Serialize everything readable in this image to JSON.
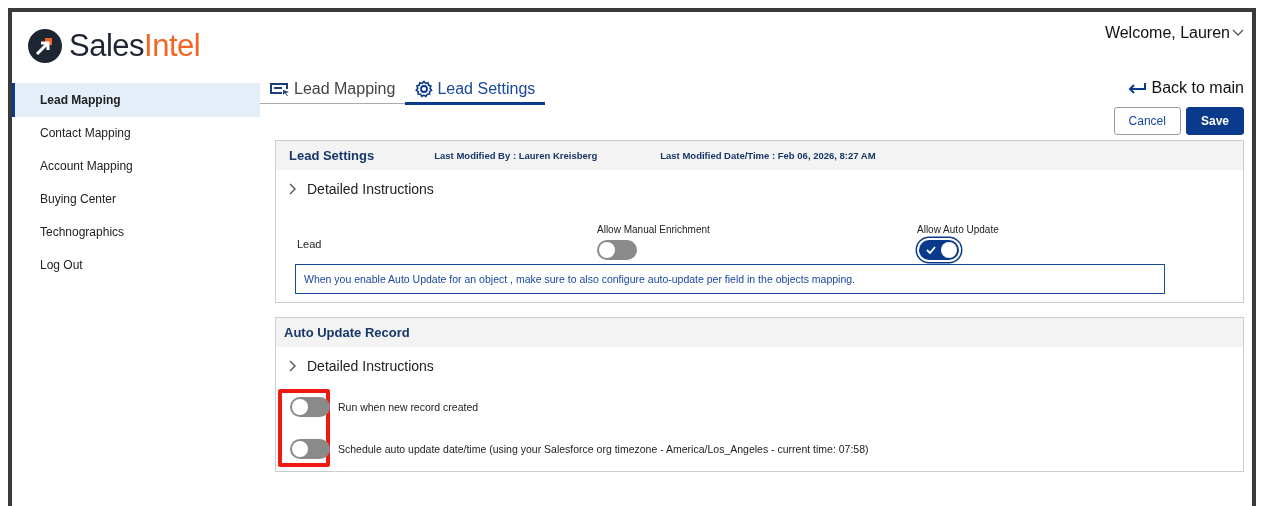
{
  "logo": {
    "dark": "Sales",
    "accent": "Intel"
  },
  "user_menu": {
    "label": "Welcome, Lauren"
  },
  "sidebar": {
    "items": [
      {
        "label": "Lead Mapping",
        "selected": true
      },
      {
        "label": "Contact Mapping",
        "selected": false
      },
      {
        "label": "Account Mapping",
        "selected": false
      },
      {
        "label": "Buying Center",
        "selected": false
      },
      {
        "label": "Technographics",
        "selected": false
      },
      {
        "label": "Log Out",
        "selected": false
      }
    ]
  },
  "tabs": [
    {
      "label": "Lead Mapping",
      "selected": false
    },
    {
      "label": "Lead Settings",
      "selected": true
    }
  ],
  "back_link": "Back to main",
  "buttons": [
    {
      "label": "Cancel",
      "kind": "secondary"
    },
    {
      "label": "Save",
      "kind": "primary"
    }
  ],
  "lead_settings": {
    "title": "Lead Settings",
    "modified_by": "Last Modified By : Lauren Kreisberg",
    "modified_at": "Last Modified Date/Time : Feb 06, 2026, 8:27 AM",
    "instructions": {
      "label": "Detailed Instructions",
      "expanded": false
    },
    "row_label": "Lead",
    "toggles": [
      {
        "label": "Allow Manual Enrichment",
        "on": false
      },
      {
        "label": "Allow Auto Update",
        "on": true
      }
    ],
    "note": "When you enable Auto Update for an object , make sure to also configure auto-update per field in the objects mapping."
  },
  "auto_update_record": {
    "title": "Auto Update Record",
    "instructions": {
      "label": "Detailed Instructions",
      "expanded": false
    },
    "highlighted": true,
    "options": [
      {
        "label": "Run when new record created",
        "on": false
      },
      {
        "label": "Schedule auto update date/time (using your Salesforce org timezone - America/Los_Angeles - current time: 07:58)",
        "on": false
      }
    ]
  }
}
